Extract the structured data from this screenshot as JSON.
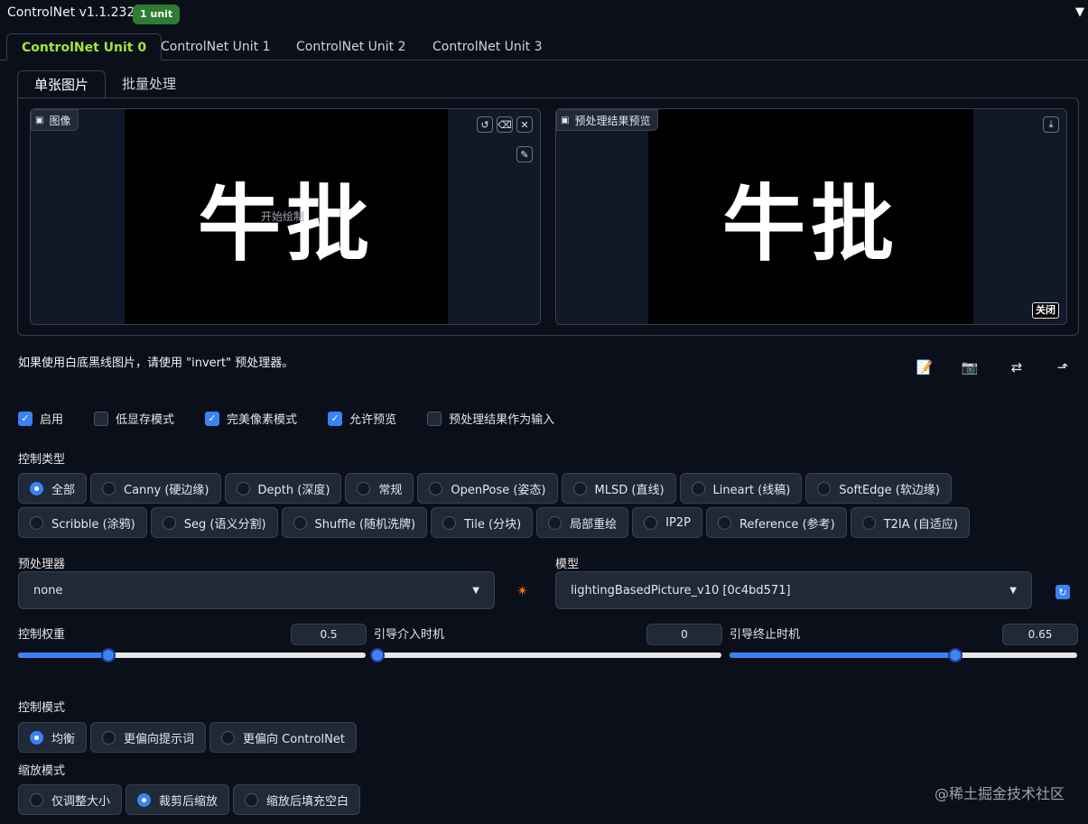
{
  "header": {
    "title": "ControlNet v1.1.232",
    "badge": "1 unit",
    "collapse_icon": "triangle-down"
  },
  "unit_tabs": [
    "ControlNet Unit 0",
    "ControlNet Unit 1",
    "ControlNet Unit 2",
    "ControlNet Unit 3"
  ],
  "sub_tabs": [
    "单张图片",
    "批量处理"
  ],
  "image_panel": {
    "label": "图像",
    "canvas_text": "牛批",
    "hint": "开始绘制"
  },
  "preview_panel": {
    "label": "预处理结果预览",
    "canvas_text": "牛批",
    "close": "关闭"
  },
  "info_text": "如果使用白底黑线图片，请使用 \"invert\" 预处理器。",
  "checkboxes": [
    {
      "label": "启用",
      "checked": true
    },
    {
      "label": "低显存模式",
      "checked": false
    },
    {
      "label": "完美像素模式",
      "checked": true
    },
    {
      "label": "允许预览",
      "checked": true
    },
    {
      "label": "预处理结果作为输入",
      "checked": false
    }
  ],
  "control_type": {
    "label": "控制类型",
    "options": [
      "全部",
      "Canny (硬边缘)",
      "Depth (深度)",
      "常规",
      "OpenPose (姿态)",
      "MLSD (直线)",
      "Lineart (线稿)",
      "SoftEdge (软边缘)",
      "Scribble (涂鸦)",
      "Seg (语义分割)",
      "Shuffle (随机洗牌)",
      "Tile (分块)",
      "局部重绘",
      "IP2P",
      "Reference (参考)",
      "T2IA (自适应)"
    ],
    "selected": "全部"
  },
  "preprocessor": {
    "label": "预处理器",
    "value": "none"
  },
  "model": {
    "label": "模型",
    "value": "lightingBasedPicture_v10 [0c4bd571]"
  },
  "sliders": [
    {
      "label": "控制权重",
      "value": "0.5",
      "fraction": 0.26
    },
    {
      "label": "引导介入时机",
      "value": "0",
      "fraction": 0.0
    },
    {
      "label": "引导终止时机",
      "value": "0.65",
      "fraction": 0.65
    }
  ],
  "control_mode": {
    "label": "控制模式",
    "options": [
      "均衡",
      "更偏向提示词",
      "更偏向 ControlNet"
    ],
    "selected": "均衡"
  },
  "resize_mode": {
    "label": "缩放模式",
    "options": [
      "仅调整大小",
      "裁剪后缩放",
      "缩放后填充空白"
    ],
    "selected": "裁剪后缩放"
  },
  "watermark": "@稀土掘金技术社区",
  "colors": {
    "accent": "#3b82f6",
    "active_tab": "#a3e635",
    "badge": "#2f7d32",
    "background": "#0b0f19"
  }
}
